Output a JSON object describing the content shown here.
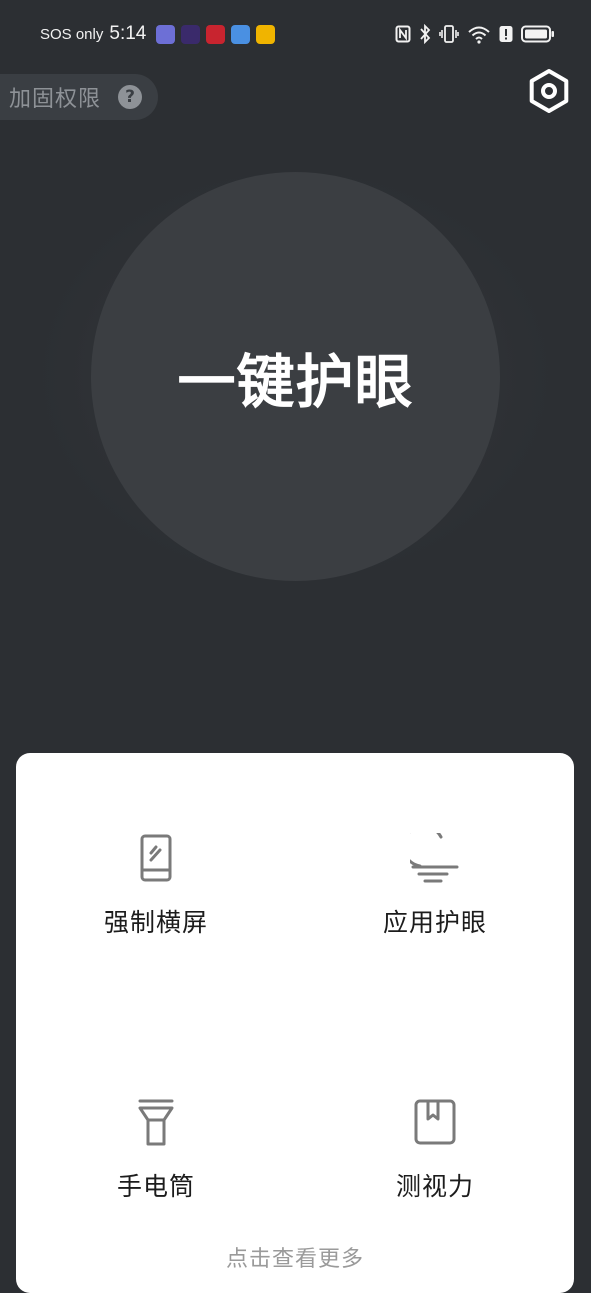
{
  "status_bar": {
    "network": "SOS only",
    "time": "5:14",
    "notification_icons": [
      {
        "name": "app-notification-icon-1",
        "color": "#6d6fd6"
      },
      {
        "name": "app-notification-icon-2",
        "color": "#3a2a6b"
      },
      {
        "name": "app-notification-icon-3",
        "color": "#c8242f"
      },
      {
        "name": "app-notification-icon-4",
        "color": "#4a90e2"
      },
      {
        "name": "app-notification-icon-5",
        "color": "#f0b400"
      }
    ],
    "system_icons": [
      "nfc-icon",
      "bluetooth-icon",
      "vibrate-icon",
      "wifi-icon",
      "alert-icon",
      "battery-icon"
    ]
  },
  "header": {
    "permission_label": "加固权限",
    "help_symbol": "?"
  },
  "main_button": {
    "label": "一键护眼"
  },
  "features": [
    {
      "label": "强制横屏",
      "icon": "phone-rotate-icon"
    },
    {
      "label": "应用护眼",
      "icon": "moon-icon"
    },
    {
      "label": "手电筒",
      "icon": "flashlight-icon"
    },
    {
      "label": "测视力",
      "icon": "eye-chart-book-icon"
    }
  ],
  "footer": {
    "more_label": "点击查看更多"
  },
  "colors": {
    "background": "#2c2f33",
    "circle": "#3b3e42",
    "card": "#ffffff",
    "muted_text": "#8e9297"
  }
}
